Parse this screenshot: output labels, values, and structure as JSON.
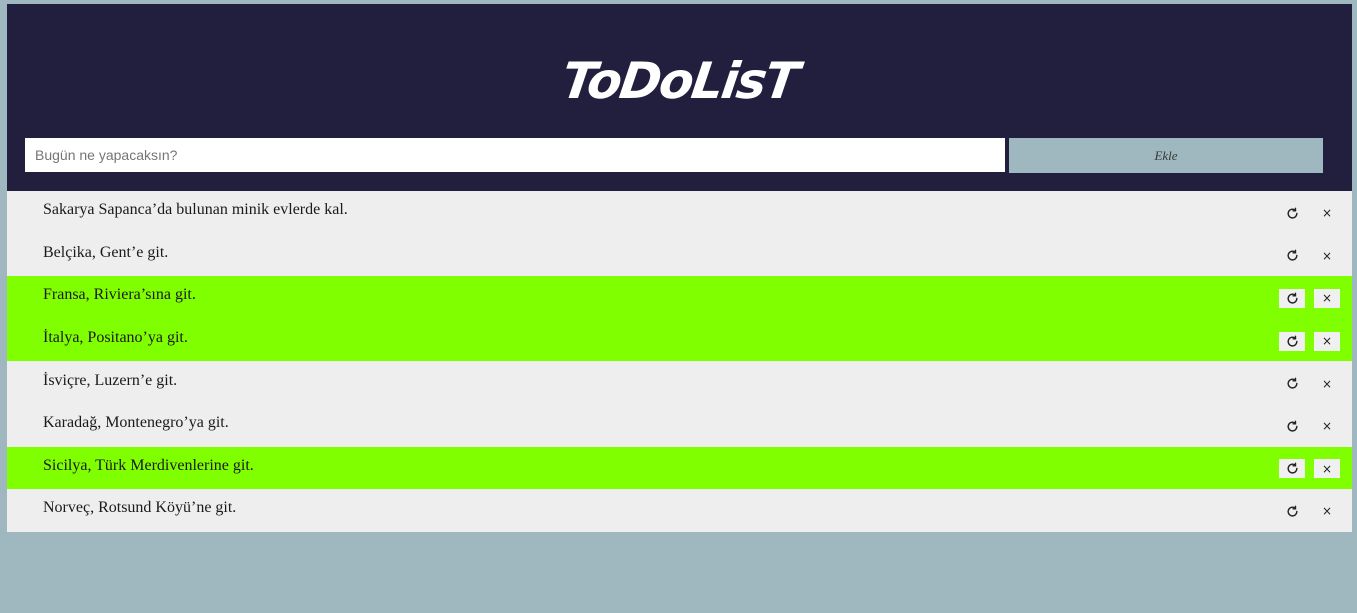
{
  "header": {
    "title": "ToDoLisT"
  },
  "input": {
    "placeholder": "Bugün ne yapacaksın?",
    "value": ""
  },
  "add_button": {
    "label": "Ekle"
  },
  "icons": {
    "refresh": "refresh-icon",
    "delete": "close-icon"
  },
  "colors": {
    "header_bg": "#221f3e",
    "page_bg": "#9fb7bf",
    "item_bg": "#eeeeee",
    "done_bg": "#80ff00"
  },
  "items": [
    {
      "text": "Sakarya Sapanca’da bulunan minik evlerde kal.",
      "done": false,
      "delete_label": "×"
    },
    {
      "text": "Belçika, Gent’e git.",
      "done": false,
      "delete_label": "×"
    },
    {
      "text": "Fransa, Riviera’sına git.",
      "done": true,
      "delete_label": "×"
    },
    {
      "text": "İtalya, Positano’ya git.",
      "done": true,
      "delete_label": "×"
    },
    {
      "text": "İsviçre, Luzern’e git.",
      "done": false,
      "delete_label": "×"
    },
    {
      "text": "Karadağ, Montenegro’ya git.",
      "done": false,
      "delete_label": "×"
    },
    {
      "text": "Sicilya, Türk Merdivenlerine git.",
      "done": true,
      "delete_label": "×"
    },
    {
      "text": "Norveç, Rotsund Köyü’ne git.",
      "done": false,
      "delete_label": "×"
    }
  ]
}
